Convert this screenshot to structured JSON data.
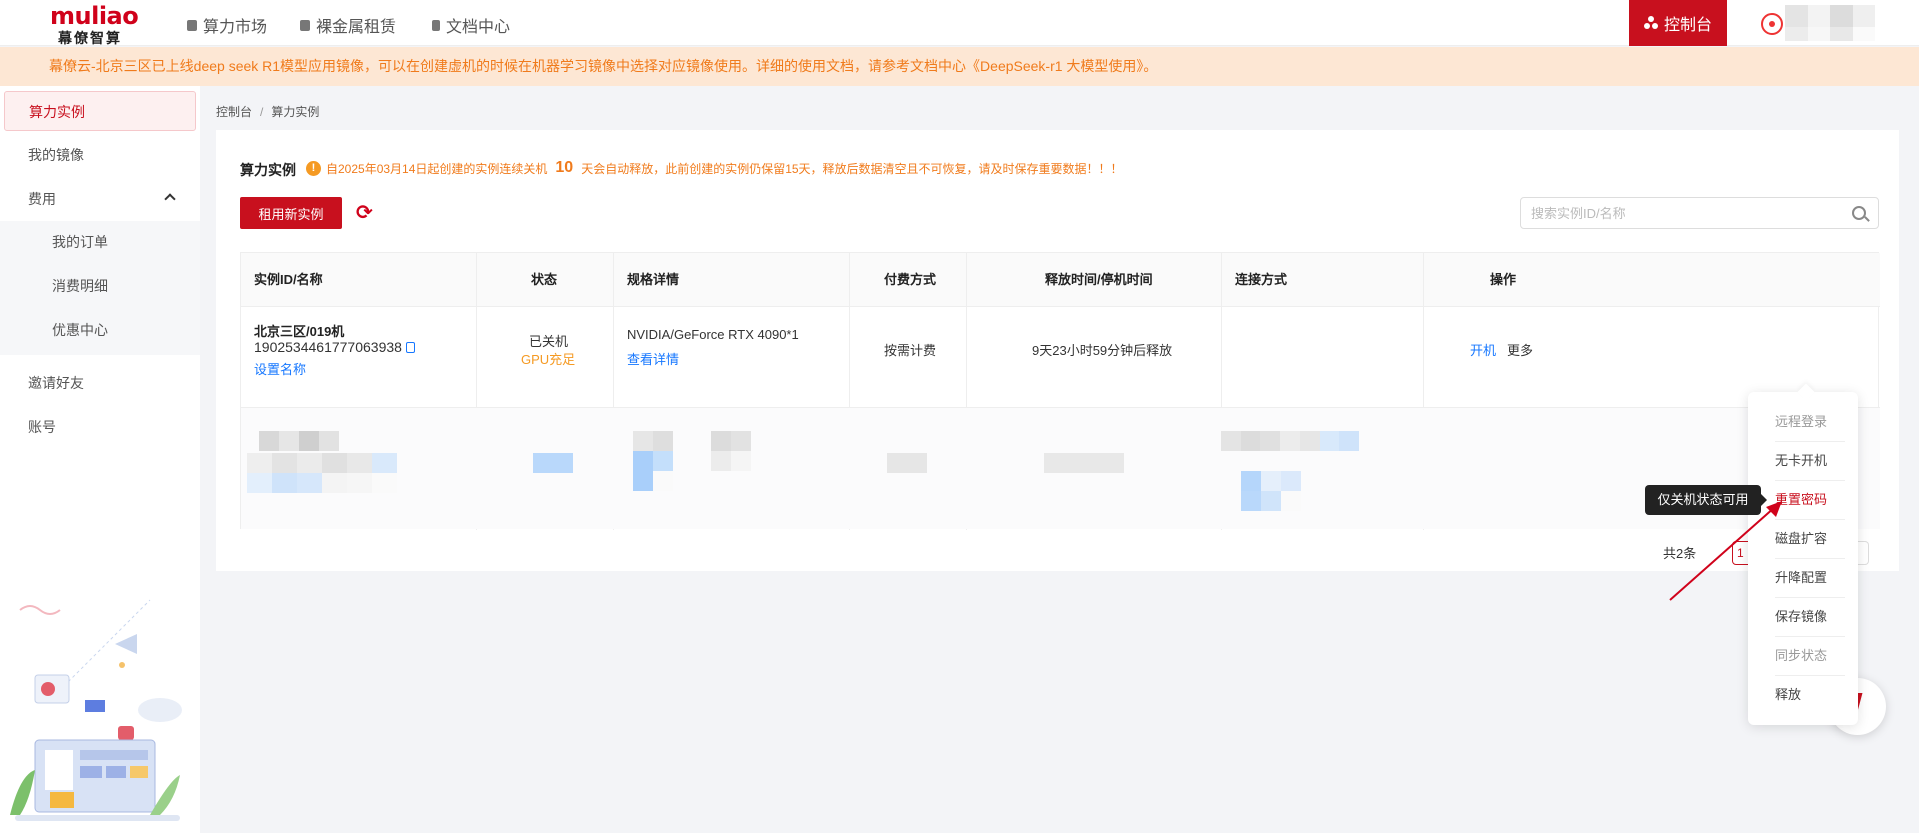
{
  "header": {
    "logo_main": "muliao",
    "logo_sub": "幕僚智算",
    "nav": [
      {
        "label": "算力市场",
        "icon": "market-icon"
      },
      {
        "label": "裸金属租赁",
        "icon": "server-icon"
      },
      {
        "label": "文档中心",
        "icon": "document-icon"
      }
    ],
    "console_label": "控制台"
  },
  "notice": "幕僚云-北京三区已上线deep seek R1模型应用镜像，可以在创建虚机的时候在机器学习镜像中选择对应镜像使用。详细的使用文档，请参考文档中心《DeepSeek-r1 大模型使用》。",
  "sidebar": {
    "items": [
      {
        "label": "算力实例"
      },
      {
        "label": "我的镜像"
      },
      {
        "label": "费用"
      },
      {
        "label": "我的订单"
      },
      {
        "label": "消费明细"
      },
      {
        "label": "优惠中心"
      },
      {
        "label": "邀请好友"
      },
      {
        "label": "账号"
      }
    ]
  },
  "breadcrumb": {
    "root": "控制台",
    "sep": "/",
    "current": "算力实例"
  },
  "main": {
    "title": "算力实例",
    "warning_prefix": "自2025年03月14日起创建的实例连续关机",
    "warning_days": "10",
    "warning_suffix": "天会自动释放，此前创建的实例仍保留15天，释放后数据清空且不可恢复，请及时保存重要数据！！！",
    "warning_icon": "!",
    "rent_button": "租用新实例",
    "search_placeholder": "搜索实例ID/名称"
  },
  "table": {
    "headers": [
      "实例ID/名称",
      "状态",
      "规格详情",
      "付费方式",
      "释放时间/停机时间",
      "连接方式",
      "操作"
    ],
    "rows": [
      {
        "name": "北京三区/019机",
        "id": "1902534461777063938",
        "set_name": "设置名称",
        "status": "已关机",
        "gpu_status": "GPU充足",
        "spec": "NVIDIA/GeForce RTX 4090*1",
        "spec_link": "查看详情",
        "billing": "按需计费",
        "release": "9天23小时59分钟后释放",
        "connect": "",
        "action_start": "开机",
        "action_more": "更多"
      }
    ]
  },
  "dropdown": {
    "items": [
      {
        "label": "远程登录",
        "state": "disabled"
      },
      {
        "label": "无卡开机",
        "state": "normal"
      },
      {
        "label": "重置密码",
        "state": "highlight"
      },
      {
        "label": "磁盘扩容",
        "state": "normal"
      },
      {
        "label": "升降配置",
        "state": "normal"
      },
      {
        "label": "保存镜像",
        "state": "normal"
      },
      {
        "label": "同步状态",
        "state": "disabled"
      },
      {
        "label": "释放",
        "state": "normal"
      }
    ],
    "tooltip": "仅关机状态可用"
  },
  "pagination": {
    "total": "共2条",
    "page": "1"
  },
  "colors": {
    "brand": "#c8101e",
    "warning": "#f07b1c",
    "link": "#1677ff",
    "notice_bg": "#fde7d4"
  }
}
